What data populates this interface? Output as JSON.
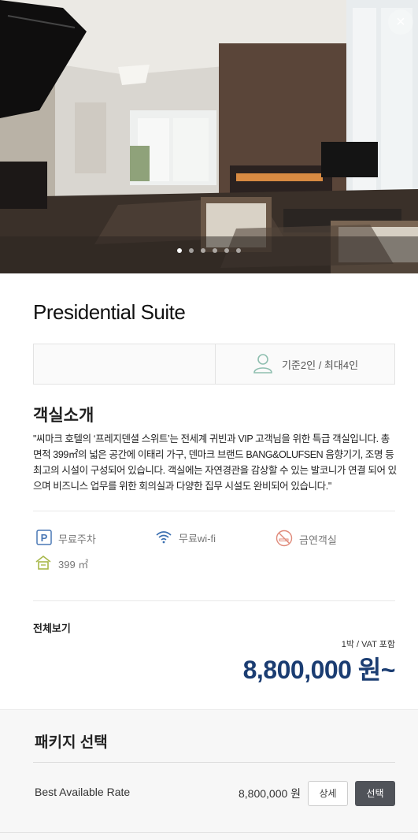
{
  "gallery": {
    "close_label": "×",
    "slide_count": 6,
    "active_slide": 1
  },
  "room": {
    "title": "Presidential Suite",
    "capacity": "기준2인 / 최대4인"
  },
  "intro": {
    "heading": "객실소개",
    "description": "\"씨마크 호텔의 ‘프레지덴셜 스위트’는 전세계 귀빈과 VIP 고객님을 위한 특급 객실입니다. 총 면적 399㎡의 넓은 공간에 이태리 가구, 덴마크 브랜드 BANG&OLUFSEN 음향기기, 조명 등 최고의 시설이 구성되어 있습니다. 객실에는 자연경관을 감상할 수 있는 발코니가 연결 되어 있으며 비즈니스 업무를 위한 회의실과 다양한 집무 시설도 완비되어 있습니다.\""
  },
  "amenities": {
    "parking": "무료주차",
    "wifi": "무료wi-fi",
    "nonsmoking": "금연객실",
    "area": "399 ㎡"
  },
  "pricing": {
    "view_all": "전체보기",
    "note": "1박 / VAT 포함",
    "price": "8,800,000 원~"
  },
  "package": {
    "heading": "패키지 선택",
    "items": [
      {
        "name": "Best Available Rate",
        "price": "8,800,000 원",
        "detail_label": "상세",
        "select_label": "선택"
      }
    ]
  },
  "colors": {
    "price": "#1b3d72",
    "parking_icon": "#4a78b5",
    "wifi_icon": "#3b6fb0",
    "nonsmoking_icon": "#e08a7a",
    "area_icon": "#a8b84a",
    "select_button": "#505359"
  }
}
